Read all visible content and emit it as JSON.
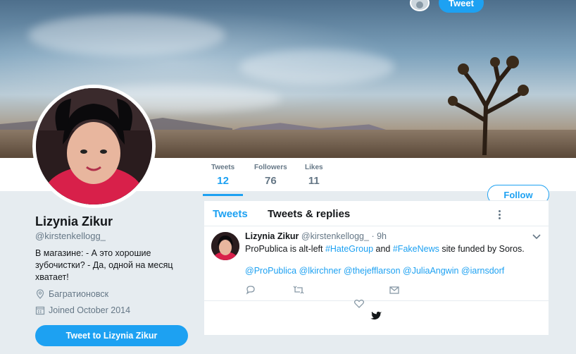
{
  "topnav": {
    "tweet_button": "Tweet"
  },
  "profile": {
    "name": "Lizynia Zikur",
    "handle": "@kirstenkellogg_",
    "bio": "В магазине: - А это хорошие зубочистки? - Да, одной на месяц хватает!",
    "location": "Багратионовск",
    "joined": "Joined October 2014",
    "tweet_to_button": "Tweet to Lizynia Zikur",
    "follow_button": "Follow"
  },
  "stats": [
    {
      "label": "Tweets",
      "value": "12"
    },
    {
      "label": "Followers",
      "value": "76"
    },
    {
      "label": "Likes",
      "value": "11"
    }
  ],
  "timeline": {
    "tabs": [
      "Tweets",
      "Tweets & replies"
    ],
    "tweet": {
      "name": "Lizynia Zikur",
      "handle": "@kirstenkellogg_",
      "time": "· 9h",
      "text_1": "ProPublica is alt-left ",
      "tag_1": "#HateGroup",
      "text_2": " and ",
      "tag_2": "#FakeNews",
      "text_3": " site funded by Soros.",
      "mentions": "@ProPublica @lkirchner @thejefflarson @JuliaAngwin @iarnsdorf"
    }
  },
  "colors": {
    "accent": "#1da1f2",
    "background": "#e6ecf0",
    "muted": "#657786"
  }
}
